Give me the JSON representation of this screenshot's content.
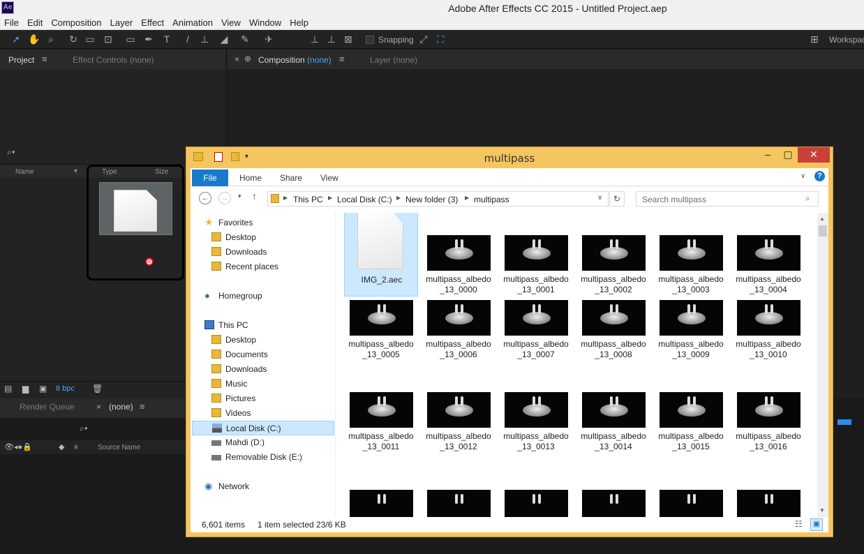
{
  "ae": {
    "title": "Adobe After Effects CC 2015 - Untitled Project.aep",
    "logo": "Ae",
    "menu": [
      "File",
      "Edit",
      "Composition",
      "Layer",
      "Effect",
      "Animation",
      "View",
      "Window",
      "Help"
    ],
    "snapping_label": "Snapping",
    "workspace_label": "Workspac",
    "project_tab": "Project",
    "effect_controls_tab": "Effect Controls (none)",
    "composition_tab": "Composition",
    "composition_none": "(none)",
    "layer_tab": "Layer (none)",
    "cols": {
      "name": "Name",
      "type": "Type",
      "size": "Size"
    },
    "bpc": "8 bpc",
    "render_queue_tab": "Render Queue",
    "timeline_tab": "(none)",
    "source_name_col": "Source Name",
    "hash_col": "#"
  },
  "explorer": {
    "title": "multipass",
    "ribbon": {
      "file": "File",
      "home": "Home",
      "share": "Share",
      "view": "View"
    },
    "breadcrumb": [
      "This PC",
      "Local Disk (C:)",
      "New folder (3)",
      "multipass"
    ],
    "search_placeholder": "Search multipass",
    "nav": {
      "favorites": "Favorites",
      "fav_items": [
        "Desktop",
        "Downloads",
        "Recent places"
      ],
      "homegroup": "Homegroup",
      "this_pc": "This PC",
      "pc_items": [
        "Desktop",
        "Documents",
        "Downloads",
        "Music",
        "Pictures",
        "Videos",
        "Local Disk (C:)",
        "Mahdi (D:)",
        "Removable Disk (E:)"
      ],
      "network": "Network"
    },
    "files": [
      {
        "name": "IMG_2.aec",
        "sub": ""
      },
      {
        "name": "multipass_albedo",
        "sub": "_13_0000"
      },
      {
        "name": "multipass_albedo",
        "sub": "_13_0001"
      },
      {
        "name": "multipass_albedo",
        "sub": "_13_0002"
      },
      {
        "name": "multipass_albedo",
        "sub": "_13_0003"
      },
      {
        "name": "multipass_albedo",
        "sub": "_13_0004"
      },
      {
        "name": "multipass_albedo",
        "sub": "_13_0005"
      },
      {
        "name": "multipass_albedo",
        "sub": "_13_0006"
      },
      {
        "name": "multipass_albedo",
        "sub": "_13_0007"
      },
      {
        "name": "multipass_albedo",
        "sub": "_13_0008"
      },
      {
        "name": "multipass_albedo",
        "sub": "_13_0009"
      },
      {
        "name": "multipass_albedo",
        "sub": "_13_0010"
      },
      {
        "name": "multipass_albedo",
        "sub": "_13_0011"
      },
      {
        "name": "multipass_albedo",
        "sub": "_13_0012"
      },
      {
        "name": "multipass_albedo",
        "sub": "_13_0013"
      },
      {
        "name": "multipass_albedo",
        "sub": "_13_0014"
      },
      {
        "name": "multipass_albedo",
        "sub": "_13_0015"
      },
      {
        "name": "multipass_albedo",
        "sub": "_13_0016"
      }
    ],
    "status": {
      "count": "6,601 items",
      "selected": "1 item selected  23/6 KB"
    }
  },
  "colors": {
    "accent_blue": "#1979ca",
    "selection": "#cce8ff",
    "window_frame": "#f5c65f",
    "ae_bg": "#232323",
    "close_red": "#e04343"
  }
}
